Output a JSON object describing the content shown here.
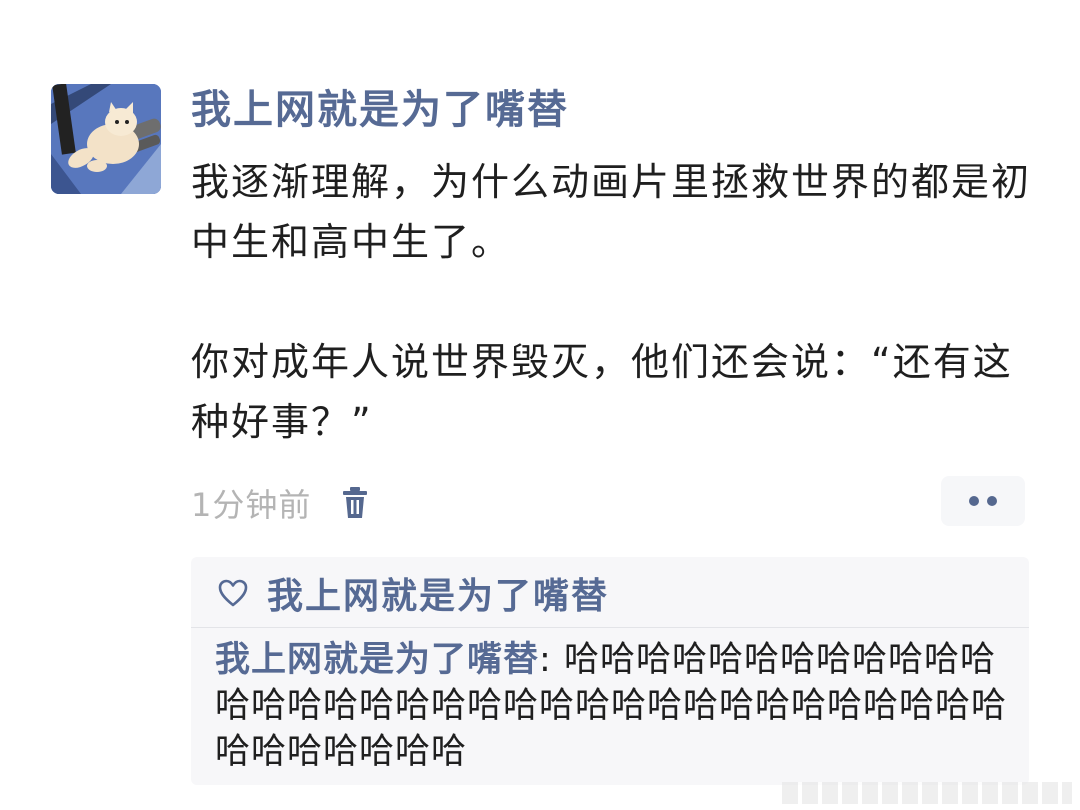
{
  "post": {
    "username": "我上网就是为了嘴替",
    "body_lines": [
      "我逐渐理解，为什么动画片里拯救世界的都是初中生和高中生了。",
      "你对成年人说世界毁灭，他们还会说：“还有这种好事？”"
    ],
    "timestamp": "1分钟前"
  },
  "icons": {
    "delete": "trash-icon",
    "more": "more-dots-icon",
    "like": "heart-icon"
  },
  "likes": {
    "names": "我上网就是为了嘴替"
  },
  "comment": {
    "author": "我上网就是为了嘴替",
    "separator": ": ",
    "text": "哈哈哈哈哈哈哈哈哈哈哈哈哈哈哈哈哈哈哈哈哈哈哈哈哈哈哈哈哈哈哈哈哈哈哈哈哈哈哈哈哈"
  },
  "colors": {
    "name_blue": "#566a94",
    "body_text": "#1f1f1f",
    "timestamp_gray": "#b4b4b4",
    "comment_bg": "#f7f7f9"
  }
}
